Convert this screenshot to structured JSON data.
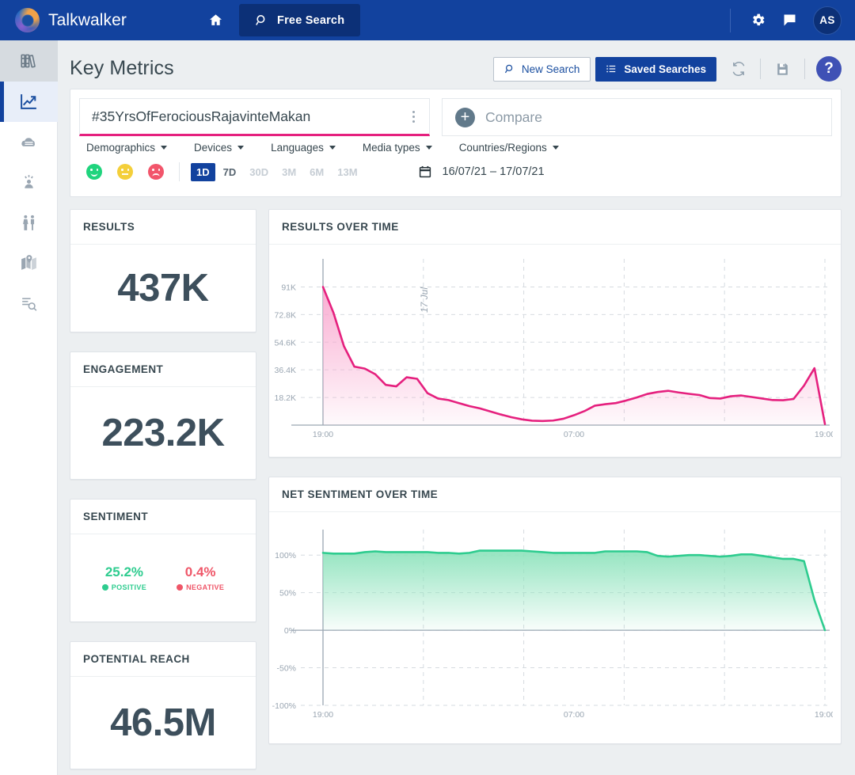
{
  "topbar": {
    "brand": "Talkwalker",
    "home_icon": "home-icon",
    "free_search_label": "Free Search",
    "search_icon": "search-icon",
    "settings_icon": "gear-icon",
    "chat_icon": "chat-bubble-icon",
    "avatar_initials": "AS"
  },
  "rail": {
    "items": [
      {
        "name": "sidebar-item-library",
        "icon": "books-icon"
      },
      {
        "name": "sidebar-item-analytics",
        "icon": "trend-chart-icon"
      },
      {
        "name": "sidebar-item-cloud",
        "icon": "cloud-icon"
      },
      {
        "name": "sidebar-item-influencers",
        "icon": "influencer-icon"
      },
      {
        "name": "sidebar-item-demographics",
        "icon": "people-icon"
      },
      {
        "name": "sidebar-item-map",
        "icon": "map-icon"
      },
      {
        "name": "sidebar-item-query-search",
        "icon": "list-search-icon"
      }
    ]
  },
  "page": {
    "title": "Key Metrics"
  },
  "actions": {
    "new_search_label": "New Search",
    "saved_searches_label": "Saved Searches",
    "refresh_icon": "refresh-icon",
    "save_icon": "floppy-save-icon",
    "help_label": "?"
  },
  "query": {
    "value": "#35YrsOfFerociousRajavinteMakan",
    "kebab_icon": "more-vertical-icon",
    "compare_placeholder": "Compare",
    "compare_icon": "plus-circle-icon",
    "accent_color": "#e5207e"
  },
  "filters": [
    {
      "label": "Demographics"
    },
    {
      "label": "Devices"
    },
    {
      "label": "Languages"
    },
    {
      "label": "Media types"
    },
    {
      "label": "Countries/Regions"
    }
  ],
  "sentiment_toggles": [
    {
      "name": "sentiment-positive-toggle",
      "icon": "smiley-positive-icon",
      "color": "#1fd47d"
    },
    {
      "name": "sentiment-neutral-toggle",
      "icon": "smiley-neutral-icon",
      "color": "#f4cf3a"
    },
    {
      "name": "sentiment-negative-toggle",
      "icon": "smiley-negative-icon",
      "color": "#f2556b"
    }
  ],
  "ranges": [
    {
      "label": "1D",
      "state": "active"
    },
    {
      "label": "7D",
      "state": "near"
    },
    {
      "label": "30D",
      "state": "dim"
    },
    {
      "label": "3M",
      "state": "dim"
    },
    {
      "label": "6M",
      "state": "dim"
    },
    {
      "label": "13M",
      "state": "dim"
    }
  ],
  "daterange": {
    "icon": "calendar-icon",
    "text": "16/07/21 – 17/07/21"
  },
  "kpis": {
    "results": {
      "title": "RESULTS",
      "value": "437K"
    },
    "engagement": {
      "title": "ENGAGEMENT",
      "value": "223.2K"
    },
    "sentiment": {
      "title": "SENTIMENT",
      "positive_pct": "25.2%",
      "positive_label": "POSITIVE",
      "negative_pct": "0.4%",
      "negative_label": "NEGATIVE"
    },
    "potential_reach": {
      "title": "POTENTIAL REACH",
      "value": "46.5M"
    }
  },
  "charts": {
    "results_over_time_title": "RESULTS OVER TIME",
    "net_sentiment_title": "NET SENTIMENT OVER TIME"
  },
  "chart_data": [
    {
      "type": "area",
      "name": "results-over-time",
      "title": "RESULTS OVER TIME",
      "xlabel": "",
      "ylabel": "",
      "line_color": "#e5207e",
      "fill_color": "#f9a8cf",
      "grid": true,
      "legend": "none",
      "ylim": [
        0,
        100100
      ],
      "ytick_labels": [
        "18.2K",
        "36.4K",
        "54.6K",
        "72.8K",
        "91K"
      ],
      "ytick_values": [
        18200,
        36400,
        54600,
        72800,
        91000
      ],
      "xtick_labels": [
        "19:00",
        "07:00",
        "19:00"
      ],
      "annotations": [
        {
          "text": "17 Jul",
          "x_index": 10,
          "rotated": true
        }
      ],
      "x": [
        "19:00",
        "19:30",
        "20:00",
        "20:30",
        "21:00",
        "21:30",
        "22:00",
        "22:30",
        "23:00",
        "23:30",
        "00:00",
        "00:30",
        "01:00",
        "01:30",
        "02:00",
        "02:30",
        "03:00",
        "03:30",
        "04:00",
        "04:30",
        "05:00",
        "05:30",
        "06:00",
        "06:30",
        "07:00",
        "07:30",
        "08:00",
        "08:30",
        "09:00",
        "09:30",
        "10:00",
        "10:30",
        "11:00",
        "11:30",
        "12:00",
        "12:30",
        "13:00",
        "13:30",
        "14:00",
        "14:30",
        "15:00",
        "15:30",
        "16:00",
        "16:30",
        "17:00",
        "17:30",
        "18:00",
        "18:30",
        "19:00"
      ],
      "values": [
        91000,
        74000,
        52000,
        38500,
        37200,
        33500,
        26500,
        25500,
        31500,
        30500,
        21000,
        17500,
        16500,
        14500,
        12500,
        11000,
        9000,
        7000,
        5200,
        3800,
        2900,
        2700,
        3000,
        4200,
        6500,
        9200,
        12800,
        13800,
        14500,
        16200,
        18200,
        20500,
        21800,
        22600,
        21500,
        20600,
        19800,
        17800,
        17500,
        19000,
        19500,
        18500,
        17500,
        16500,
        16400,
        17200,
        26000,
        37500,
        700
      ]
    },
    {
      "type": "area",
      "name": "net-sentiment-over-time",
      "title": "NET SENTIMENT OVER TIME",
      "xlabel": "",
      "ylabel": "",
      "line_color": "#2ecc8f",
      "fill_color": "#8fe3bd",
      "grid": true,
      "legend": "none",
      "ylim": [
        -100,
        115
      ],
      "ytick_labels": [
        "100%",
        "50%",
        "0%",
        "-50%",
        "-100%"
      ],
      "ytick_values": [
        100,
        50,
        0,
        -50,
        -100
      ],
      "xtick_labels": [
        "19:00",
        "07:00",
        "19:00"
      ],
      "x": [
        "19:00",
        "19:30",
        "20:00",
        "20:30",
        "21:00",
        "21:30",
        "22:00",
        "22:30",
        "23:00",
        "23:30",
        "00:00",
        "00:30",
        "01:00",
        "01:30",
        "02:00",
        "02:30",
        "03:00",
        "03:30",
        "04:00",
        "04:30",
        "05:00",
        "05:30",
        "06:00",
        "06:30",
        "07:00",
        "07:30",
        "08:00",
        "08:30",
        "09:00",
        "09:30",
        "10:00",
        "10:30",
        "11:00",
        "11:30",
        "12:00",
        "12:30",
        "13:00",
        "13:30",
        "14:00",
        "14:30",
        "15:00",
        "15:30",
        "16:00",
        "16:30",
        "17:00",
        "17:30",
        "18:00",
        "18:30",
        "19:00"
      ],
      "values": [
        103,
        102,
        102,
        102,
        104,
        105,
        104,
        104,
        104,
        104,
        104,
        103,
        103,
        102,
        103,
        106,
        106,
        106,
        106,
        106,
        105,
        104,
        103,
        103,
        103,
        103,
        103,
        105,
        105,
        105,
        105,
        104,
        99,
        98,
        99,
        100,
        100,
        99,
        98,
        99,
        101,
        101,
        99,
        97,
        95,
        95,
        92,
        40,
        0
      ]
    }
  ]
}
